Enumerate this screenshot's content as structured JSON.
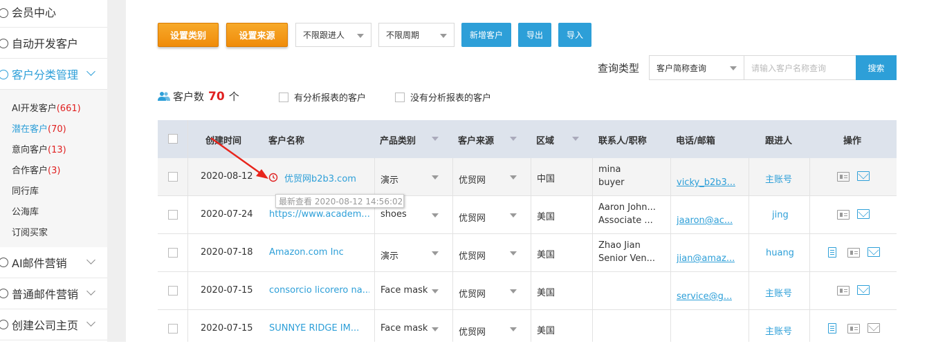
{
  "sidebar": {
    "items": [
      {
        "label": "会员中心"
      },
      {
        "label": "自动开发客户"
      },
      {
        "label": "客户分类管理"
      },
      {
        "label": "AI邮件营销"
      },
      {
        "label": "普通邮件营销"
      },
      {
        "label": "创建公司主页"
      }
    ],
    "sub_items": [
      {
        "label": "AI开发客户",
        "count": "(661)"
      },
      {
        "label": "潜在客户",
        "count": "(70)"
      },
      {
        "label": "意向客户",
        "count": "(13)"
      },
      {
        "label": "合作客户",
        "count": "(3)"
      },
      {
        "label": "同行库",
        "count": ""
      },
      {
        "label": "公海库",
        "count": ""
      },
      {
        "label": "订阅买家",
        "count": ""
      }
    ]
  },
  "toolbar": {
    "set_category": "设置类别",
    "set_source": "设置来源",
    "followup_select": "不限跟进人",
    "period_select": "不限周期",
    "add_customer": "新增客户",
    "export": "导出",
    "import": "导入"
  },
  "search": {
    "label": "查询类型",
    "type_select": "客户简称查询",
    "placeholder": "请输入客户名称查询",
    "button": "搜索"
  },
  "summary": {
    "prefix": "客户数",
    "count": "70",
    "suffix": "个",
    "filter_with_report": "有分析报表的客户",
    "filter_without_report": "没有分析报表的客户"
  },
  "table": {
    "headers": [
      "创建时间",
      "客户名称",
      "产品类别",
      "客户来源",
      "区域",
      "联系人/职称",
      "电话/邮箱",
      "跟进人",
      "操作"
    ],
    "rows": [
      {
        "date": "2020-08-12",
        "name": "优贸网b2b3.com",
        "product": "演示",
        "source": "优贸网",
        "region": "中国",
        "contact": "mina",
        "title": "buyer",
        "email": "vicky_b2b3...",
        "owner": "主账号"
      },
      {
        "date": "2020-07-24",
        "name": "https://www.academ...",
        "product": "shoes",
        "source": "优贸网",
        "region": "美国",
        "contact": "Aaron John...",
        "title": "Associate ...",
        "email": "jaaron@ac...",
        "owner": "jing"
      },
      {
        "date": "2020-07-18",
        "name": "Amazon.com Inc",
        "product": "演示",
        "source": "优贸网",
        "region": "美国",
        "contact": "Zhao Jian",
        "title": "Senior Ven...",
        "email": "jian@amaz...",
        "owner": "huang"
      },
      {
        "date": "2020-07-15",
        "name": "consorcio licorero na...",
        "product": "Face mask",
        "source": "优贸网",
        "region": "美国",
        "contact": "",
        "title": "",
        "email": "service@g...",
        "owner": "主账号"
      },
      {
        "date": "2020-07-15",
        "name": "SUNNYE RIDGE IM...",
        "product": "Face mask",
        "source": "优贸网",
        "region": "美国",
        "contact": "",
        "title": "",
        "email": "",
        "owner": "主账号"
      }
    ]
  },
  "tooltip": "最新查看  2020-08-12 14:56:02",
  "colors": {
    "accent": "#2d9fd8",
    "orange": "#f39a1a",
    "red": "#e02020",
    "header_bg": "#dde3ec"
  }
}
